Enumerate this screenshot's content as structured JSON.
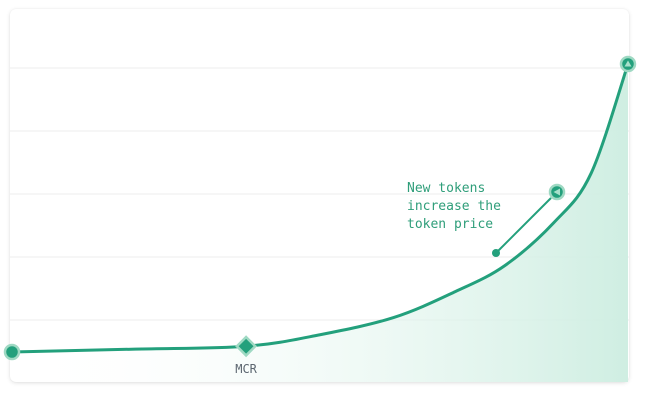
{
  "chart_data": {
    "type": "area",
    "title": "",
    "xlabel": "",
    "ylabel": "",
    "series": [
      {
        "curve": "exponential",
        "x": [
          0,
          0.2,
          0.38,
          0.5,
          0.62,
          0.72,
          0.8,
          0.88,
          0.94,
          1.0
        ],
        "y": [
          0,
          0.01,
          0.02,
          0.06,
          0.12,
          0.21,
          0.3,
          0.45,
          0.62,
          1.0
        ]
      }
    ],
    "grid": true,
    "markers": [
      {
        "label": "",
        "x": 0,
        "shape": "circle"
      },
      {
        "label": "MCR",
        "x": 0.38,
        "shape": "diamond"
      },
      {
        "label": "",
        "x": 1.0,
        "shape": "circle-triangle"
      }
    ],
    "annotation": {
      "lines": [
        "New tokens",
        "increase the",
        "token price"
      ]
    },
    "colors": {
      "line": "#23a07c",
      "fill": "#d6efe6",
      "marker": "#23a07c",
      "marker_stroke": "#9fd9c3",
      "grid": "#ececec",
      "annotation": "#2f9e7a",
      "tick_label": "#5c6670"
    }
  }
}
